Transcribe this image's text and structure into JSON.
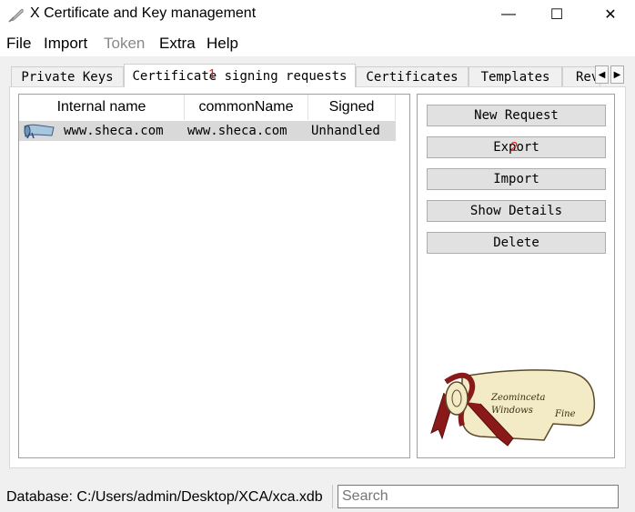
{
  "window": {
    "title": "X Certificate and Key management",
    "minimize": "—",
    "maximize": "☐",
    "close": "✕"
  },
  "menu": [
    "File",
    "Import",
    "Token",
    "Extra",
    "Help"
  ],
  "tabs": [
    "Private Keys",
    "Certificate signing requests",
    "Certificates",
    "Templates",
    "Rev"
  ],
  "active_tab": "Certificate signing requests",
  "table": {
    "columns": [
      "Internal name",
      "commonName",
      "Signed"
    ],
    "rows": [
      {
        "internal_name": "www.sheca.com",
        "common_name": "www.sheca.com",
        "signed": "Unhandled"
      }
    ]
  },
  "buttons": [
    "New Request",
    "Export",
    "Import",
    "Show Details",
    "Delete"
  ],
  "markers": [
    "1",
    "2"
  ],
  "scroll_text": [
    "Zeominceta",
    "Windows",
    "Fine"
  ],
  "status": {
    "database": "Database: C:/Users/admin/Desktop/XCA/xca.xdb",
    "search_placeholder": "Search"
  }
}
